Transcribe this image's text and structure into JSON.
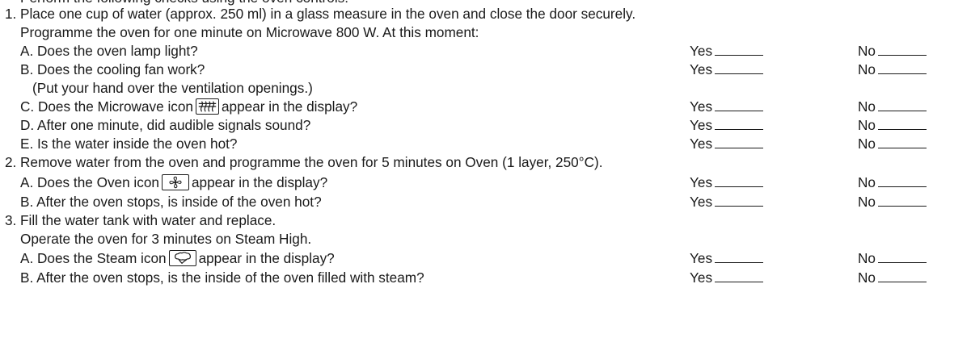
{
  "intro_cut": "Perform the following checks using the oven controls:",
  "answers": {
    "yes": "Yes",
    "no": "No"
  },
  "steps": [
    {
      "number": "1.",
      "lines": [
        "Place one cup of water (approx. 250 ml) in a glass measure in the oven and close the door securely.",
        "Programme the oven for one minute on Microwave 800 W. At this moment:"
      ],
      "questions": [
        {
          "text": "A. Does the oven lamp light?"
        },
        {
          "text": "B. Does the cooling fan work?",
          "note": "(Put your hand over the ventilation openings.)"
        },
        {
          "before": "C. Does the Microwave icon",
          "icon": "microwave-icon",
          "after": "appear in the display?"
        },
        {
          "text": "D. After one minute, did audible signals sound?"
        },
        {
          "text": "E. Is the water inside the oven hot?"
        }
      ]
    },
    {
      "number": "2.",
      "lines": [
        "Remove water from the oven and programme the oven for 5 minutes on Oven (1 layer, 250°C)."
      ],
      "questions": [
        {
          "before": "A. Does the Oven icon",
          "icon": "fan-oven-icon",
          "after": "appear in the display?"
        },
        {
          "text": "B. After the oven stops, is inside of the oven hot?"
        }
      ]
    },
    {
      "number": "3.",
      "lines": [
        "Fill the water tank with water and replace.",
        "Operate the oven for 3 minutes on Steam High."
      ],
      "questions": [
        {
          "before": "A. Does the Steam icon",
          "icon": "steam-icon",
          "after": "appear in the display?"
        },
        {
          "text": "B. After the oven stops, is the inside of the oven filled with steam?"
        }
      ]
    }
  ]
}
